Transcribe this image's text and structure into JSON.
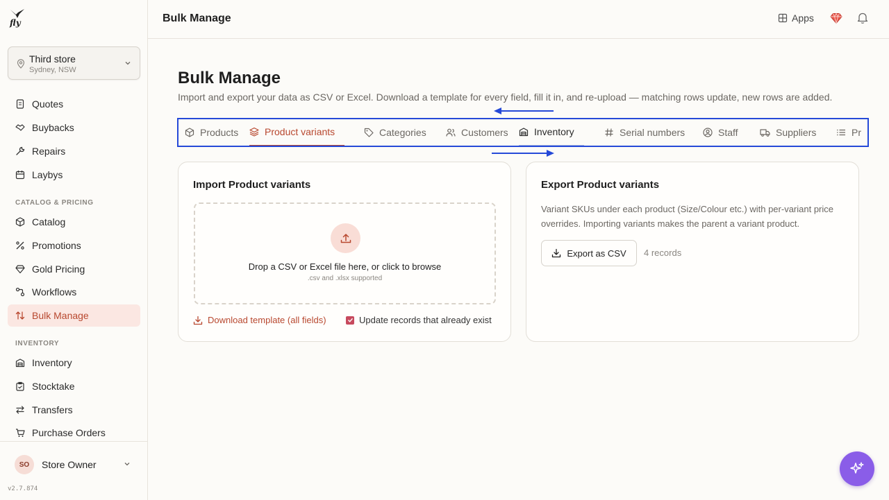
{
  "app": {
    "logo_text": "fly",
    "version": "v2.7.874"
  },
  "store": {
    "name": "Third store",
    "location": "Sydney, NSW"
  },
  "sidebar": {
    "top_items": [
      {
        "label": "Quotes",
        "icon": "document-icon"
      },
      {
        "label": "Buybacks",
        "icon": "handshake-icon"
      },
      {
        "label": "Repairs",
        "icon": "wrench-icon"
      },
      {
        "label": "Laybys",
        "icon": "calendar-icon"
      }
    ],
    "section_catalog": "CATALOG & PRICING",
    "catalog_items": [
      {
        "label": "Catalog",
        "icon": "box-icon"
      },
      {
        "label": "Promotions",
        "icon": "percent-icon"
      },
      {
        "label": "Gold Pricing",
        "icon": "gem-icon"
      },
      {
        "label": "Workflows",
        "icon": "workflow-icon"
      },
      {
        "label": "Bulk Manage",
        "icon": "swap-icon",
        "active": true
      }
    ],
    "section_inventory": "INVENTORY",
    "inventory_items": [
      {
        "label": "Inventory",
        "icon": "warehouse-icon"
      },
      {
        "label": "Stocktake",
        "icon": "clipboard-icon"
      },
      {
        "label": "Transfers",
        "icon": "transfer-icon"
      },
      {
        "label": "Purchase Orders",
        "icon": "cart-icon"
      }
    ]
  },
  "user": {
    "initials": "SO",
    "name": "Store Owner"
  },
  "topbar": {
    "title": "Bulk Manage",
    "apps_label": "Apps"
  },
  "page": {
    "title": "Bulk Manage",
    "description": "Import and export your data as CSV or Excel. Download a template for every field, fill it in, and re-upload — matching rows update, new rows are added."
  },
  "tabs": [
    {
      "label": "Products",
      "icon": "cube-icon"
    },
    {
      "label": "Product variants",
      "icon": "layers-icon",
      "active": true
    },
    {
      "label": "Categories",
      "icon": "tag-icon"
    },
    {
      "label": "Customers",
      "icon": "users-icon"
    },
    {
      "label": "Inventory",
      "icon": "warehouse-icon"
    },
    {
      "label": "Serial numbers",
      "icon": "hash-icon"
    },
    {
      "label": "Staff",
      "icon": "user-circle-icon"
    },
    {
      "label": "Suppliers",
      "icon": "truck-icon"
    },
    {
      "label": "Pr",
      "icon": "list-icon"
    }
  ],
  "import_card": {
    "title": "Import Product variants",
    "drop_text": "Drop a CSV or Excel file here, or click to browse",
    "drop_sub": ".csv and .xlsx supported",
    "download_label": "Download template (all fields)",
    "update_label": "Update records that already exist",
    "update_checked": true
  },
  "export_card": {
    "title": "Export Product variants",
    "description": "Variant SKUs under each product (Size/Colour etc.) with per-variant price overrides. Importing variants makes the parent a variant product.",
    "button_label": "Export as CSV",
    "records": "4 records"
  },
  "colors": {
    "accent": "#b8482f",
    "annotation": "#2549d8",
    "fab": "#8a5de8"
  }
}
